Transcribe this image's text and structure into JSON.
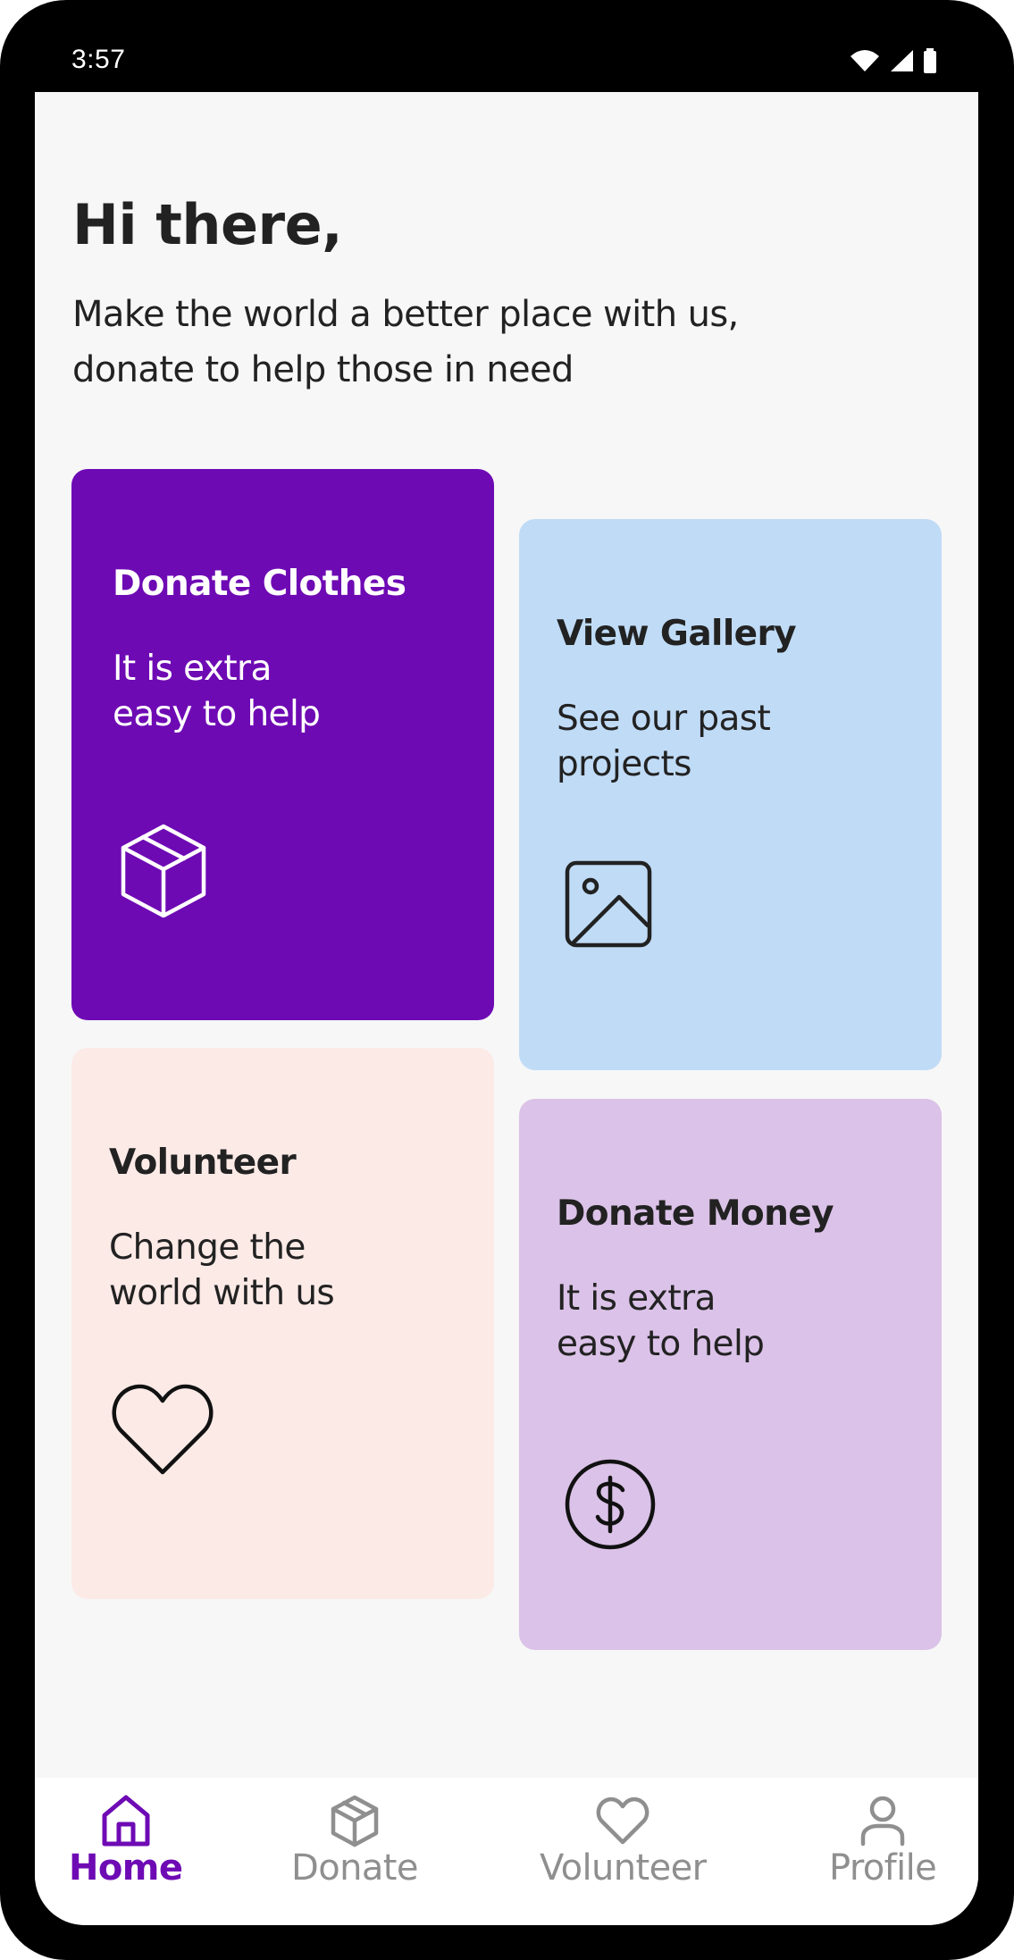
{
  "status_bar": {
    "time": "3:57",
    "icons": [
      "wifi-icon",
      "signal-icon",
      "battery-icon"
    ]
  },
  "header": {
    "greeting": "Hi there,",
    "subtitle": "Make the world a better place with us, donate to help those in need"
  },
  "cards": {
    "donate_clothes": {
      "title": "Donate Clothes",
      "description": "It is extra easy to help",
      "icon": "box-icon",
      "color": "#6e0ab4"
    },
    "view_gallery": {
      "title": "View Gallery",
      "description": "See our past projects",
      "icon": "image-icon",
      "color": "#c0dbf6"
    },
    "volunteer": {
      "title": "Volunteer",
      "description": "Change the world with us",
      "icon": "heart-icon",
      "color": "#fceae7"
    },
    "donate_money": {
      "title": "Donate Money",
      "description": "It is extra easy to help",
      "icon": "dollar-icon",
      "color": "#dbc2e8"
    }
  },
  "bottom_nav": {
    "items": [
      {
        "label": "Home",
        "icon": "home-icon",
        "active": true
      },
      {
        "label": "Donate",
        "icon": "box-icon",
        "active": false
      },
      {
        "label": "Volunteer",
        "icon": "heart-icon",
        "active": false
      },
      {
        "label": "Profile",
        "icon": "person-icon",
        "active": false
      }
    ],
    "active_color": "#6e0ab4",
    "inactive_color": "#8f8f8f"
  }
}
